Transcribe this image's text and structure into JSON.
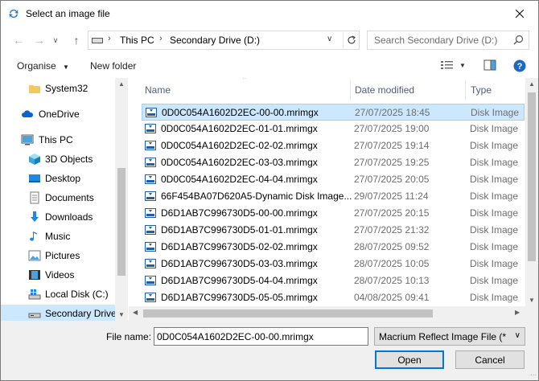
{
  "window": {
    "title": "Select an image file"
  },
  "nav": {
    "back_icon": "arrow-left",
    "forward_icon": "arrow-right",
    "recent_icon": "chevron-down",
    "up_icon": "arrow-up",
    "breadcrumbs": [
      "This PC",
      "Secondary Drive (D:)"
    ],
    "search_placeholder": "Search Secondary Drive (D:)"
  },
  "toolbar": {
    "organise_label": "Organise",
    "new_folder_label": "New folder"
  },
  "sidebar": {
    "items": [
      {
        "label": "System32",
        "icon": "folder-icon"
      },
      {
        "label": "OneDrive",
        "icon": "cloud-icon"
      },
      {
        "label": "This PC",
        "icon": "monitor-icon"
      },
      {
        "label": "3D Objects",
        "icon": "cube-icon"
      },
      {
        "label": "Desktop",
        "icon": "desktop-icon"
      },
      {
        "label": "Documents",
        "icon": "documents-icon"
      },
      {
        "label": "Downloads",
        "icon": "download-icon"
      },
      {
        "label": "Music",
        "icon": "music-icon"
      },
      {
        "label": "Pictures",
        "icon": "pictures-icon"
      },
      {
        "label": "Videos",
        "icon": "videos-icon"
      },
      {
        "label": "Local Disk (C:)",
        "icon": "windows-drive-icon"
      },
      {
        "label": "Secondary Drive",
        "icon": "drive-icon"
      }
    ]
  },
  "columns": {
    "name": "Name",
    "date": "Date modified",
    "type": "Type"
  },
  "files": [
    {
      "name": "0D0C054A1602D2EC-00-00.mrimgx",
      "date": "27/07/2025 18:45",
      "type": "Disk Image"
    },
    {
      "name": "0D0C054A1602D2EC-01-01.mrimgx",
      "date": "27/07/2025 19:00",
      "type": "Disk Image"
    },
    {
      "name": "0D0C054A1602D2EC-02-02.mrimgx",
      "date": "27/07/2025 19:14",
      "type": "Disk Image"
    },
    {
      "name": "0D0C054A1602D2EC-03-03.mrimgx",
      "date": "27/07/2025 19:25",
      "type": "Disk Image"
    },
    {
      "name": "0D0C054A1602D2EC-04-04.mrimgx",
      "date": "27/07/2025 20:05",
      "type": "Disk Image"
    },
    {
      "name": "66F454BA07D620A5-Dynamic Disk Image...",
      "date": "29/07/2025 11:24",
      "type": "Disk Image"
    },
    {
      "name": "D6D1AB7C996730D5-00-00.mrimgx",
      "date": "27/07/2025 20:15",
      "type": "Disk Image"
    },
    {
      "name": "D6D1AB7C996730D5-01-01.mrimgx",
      "date": "27/07/2025 21:32",
      "type": "Disk Image"
    },
    {
      "name": "D6D1AB7C996730D5-02-02.mrimgx",
      "date": "28/07/2025 09:52",
      "type": "Disk Image"
    },
    {
      "name": "D6D1AB7C996730D5-03-03.mrimgx",
      "date": "28/07/2025 10:05",
      "type": "Disk Image"
    },
    {
      "name": "D6D1AB7C996730D5-04-04.mrimgx",
      "date": "28/07/2025 10:13",
      "type": "Disk Image"
    },
    {
      "name": "D6D1AB7C996730D5-05-05.mrimgx",
      "date": "04/08/2025 09:41",
      "type": "Disk Image"
    }
  ],
  "selected_file_index": 0,
  "bottom": {
    "filename_label": "File name:",
    "filename_value": "0D0C054A1602D2EC-00-00.mrimgx",
    "filter_value": "Macrium Reflect Image File (*.r",
    "open_label": "Open",
    "cancel_label": "Cancel"
  },
  "colors": {
    "selection": "#cce8ff",
    "selection_border": "#99d1ff",
    "accent": "#0078d7"
  }
}
